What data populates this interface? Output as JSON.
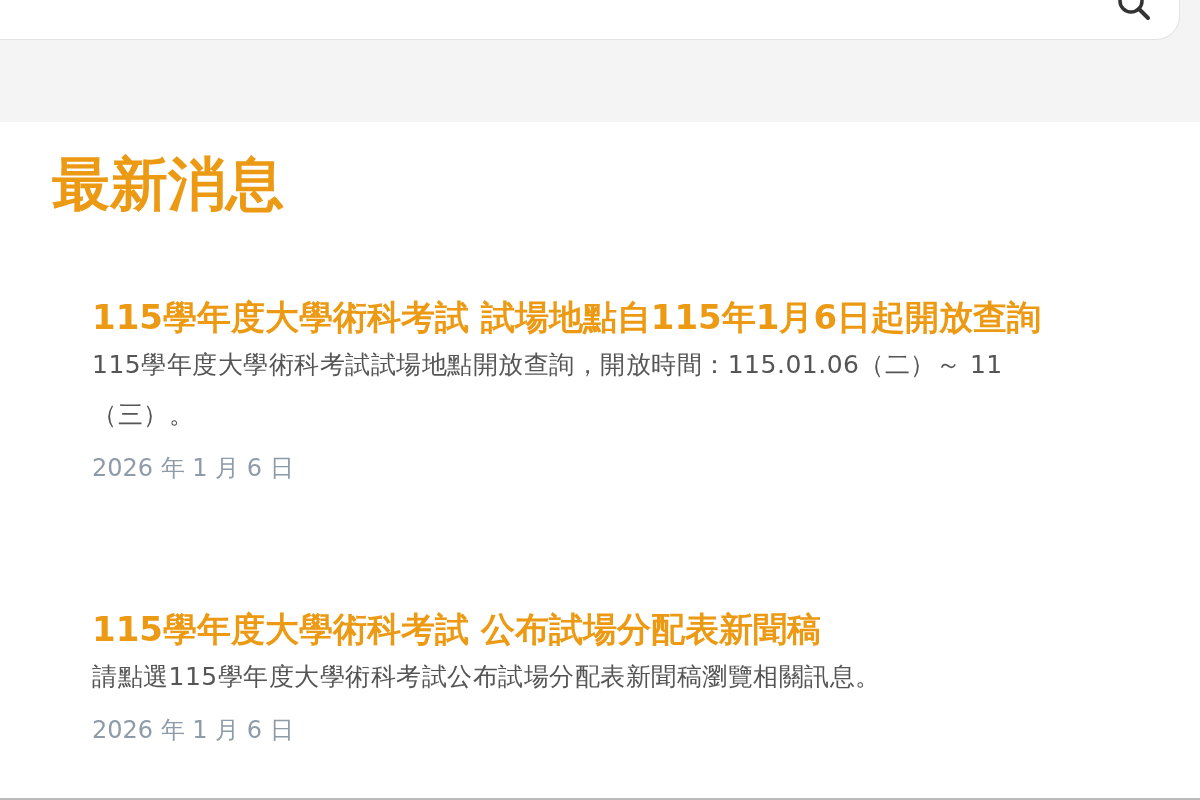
{
  "section_title": "最新消息",
  "news": [
    {
      "title": "115學年度大學術科考試 試場地點自115年1月6日起開放查詢",
      "description_lines": [
        "115學年度大學術科考試試場地點開放查詢，開放時間：115.01.06（二）～ 11",
        "（三）。"
      ],
      "date": "2026 年 1 月 6 日"
    },
    {
      "title": "115學年度大學術科考試 公布試場分配表新聞稿",
      "description_lines": [
        "請點選115學年度大學術科考試公布試場分配表新聞稿瀏覽相關訊息。"
      ],
      "date": "2026 年 1 月 6 日"
    }
  ]
}
